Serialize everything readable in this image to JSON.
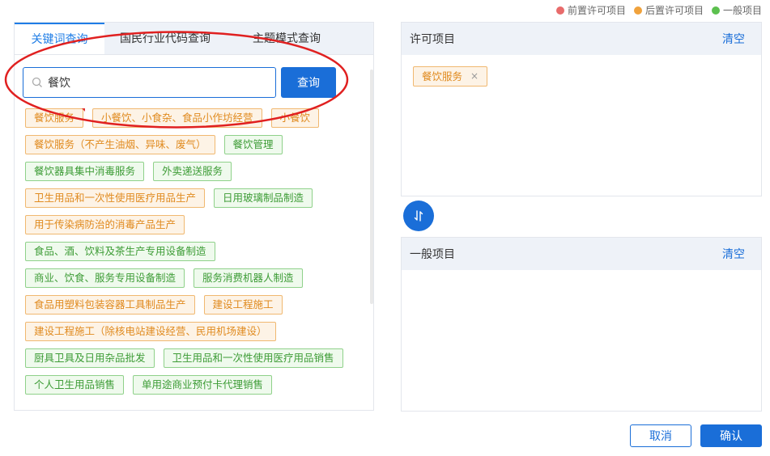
{
  "legend": [
    {
      "label": "前置许可项目",
      "color": "#e86b6b"
    },
    {
      "label": "后置许可项目",
      "color": "#f0a23c"
    },
    {
      "label": "一般项目",
      "color": "#5cc04f"
    }
  ],
  "tabs": [
    {
      "label": "关键词查询"
    },
    {
      "label": "国民行业代码查询"
    },
    {
      "label": "主题模式查询"
    }
  ],
  "search": {
    "value": "餐饮",
    "button_label": "查询"
  },
  "tag_rows": [
    [
      {
        "label": "餐饮服务",
        "type": "orange",
        "mark": true
      },
      {
        "label": "小餐饮、小食杂、食品小作坊经营",
        "type": "orange"
      },
      {
        "label": "小餐饮",
        "type": "orange"
      }
    ],
    [
      {
        "label": "餐饮服务（不产生油烟、异味、废气）",
        "type": "orange"
      },
      {
        "label": "餐饮管理",
        "type": "green"
      }
    ],
    [
      {
        "label": "餐饮器具集中消毒服务",
        "type": "green"
      },
      {
        "label": "外卖递送服务",
        "type": "green"
      }
    ],
    [
      {
        "label": "卫生用品和一次性使用医疗用品生产",
        "type": "orange"
      },
      {
        "label": "日用玻璃制品制造",
        "type": "green"
      }
    ],
    [
      {
        "label": "用于传染病防治的消毒产品生产",
        "type": "orange"
      }
    ],
    [
      {
        "label": "食品、酒、饮料及茶生产专用设备制造",
        "type": "green"
      }
    ],
    [
      {
        "label": "商业、饮食、服务专用设备制造",
        "type": "green"
      },
      {
        "label": "服务消费机器人制造",
        "type": "green"
      }
    ],
    [
      {
        "label": "食品用塑料包装容器工具制品生产",
        "type": "orange"
      },
      {
        "label": "建设工程施工",
        "type": "orange"
      }
    ],
    [
      {
        "label": "建设工程施工（除核电站建设经营、民用机场建设）",
        "type": "orange"
      }
    ],
    [
      {
        "label": "厨具卫具及日用杂品批发",
        "type": "green"
      },
      {
        "label": "卫生用品和一次性使用医疗用品销售",
        "type": "green"
      }
    ],
    [
      {
        "label": "个人卫生用品销售",
        "type": "green"
      },
      {
        "label": "单用途商业预付卡代理销售",
        "type": "green"
      }
    ]
  ],
  "permit_box": {
    "title": "许可项目",
    "clear_label": "清空",
    "selected": [
      {
        "label": "餐饮服务",
        "remove": "×"
      }
    ]
  },
  "general_box": {
    "title": "一般项目",
    "clear_label": "清空"
  },
  "footer": {
    "cancel_label": "取消",
    "confirm_label": "确认"
  },
  "annotation": {
    "color": "#e02020"
  }
}
